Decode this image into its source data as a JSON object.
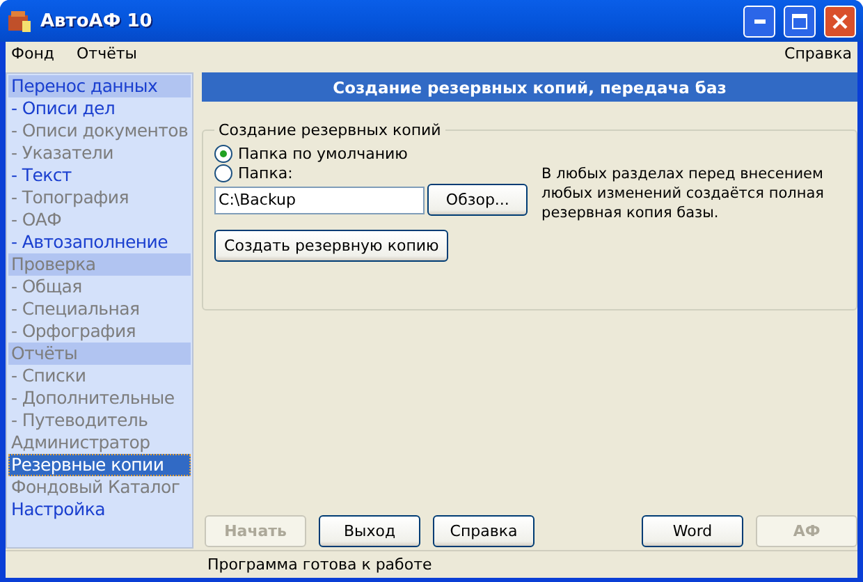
{
  "window": {
    "title": "АвтоАФ 10"
  },
  "menu": {
    "left": [
      {
        "label": "Фонд"
      },
      {
        "label": "Отчёты"
      }
    ],
    "right": [
      {
        "label": "Справка"
      }
    ]
  },
  "sidebar": {
    "items": [
      {
        "label": "Перенос данных",
        "kind": "header",
        "enabled": true,
        "selected": false
      },
      {
        "label": "- Описи дел",
        "kind": "item",
        "enabled": true,
        "selected": false
      },
      {
        "label": "- Описи документов",
        "kind": "item",
        "enabled": false,
        "selected": false
      },
      {
        "label": "- Указатели",
        "kind": "item",
        "enabled": false,
        "selected": false
      },
      {
        "label": "- Текст",
        "kind": "item",
        "enabled": true,
        "selected": false
      },
      {
        "label": "- Топография",
        "kind": "item",
        "enabled": false,
        "selected": false
      },
      {
        "label": "- ОАФ",
        "kind": "item",
        "enabled": false,
        "selected": false
      },
      {
        "label": "- Автозаполнение",
        "kind": "item",
        "enabled": true,
        "selected": false
      },
      {
        "label": "Проверка",
        "kind": "header",
        "enabled": false,
        "selected": false
      },
      {
        "label": "- Общая",
        "kind": "item",
        "enabled": false,
        "selected": false
      },
      {
        "label": "- Специальная",
        "kind": "item",
        "enabled": false,
        "selected": false
      },
      {
        "label": "- Орфография",
        "kind": "item",
        "enabled": false,
        "selected": false
      },
      {
        "label": "Отчёты",
        "kind": "header",
        "enabled": false,
        "selected": false
      },
      {
        "label": "- Списки",
        "kind": "item",
        "enabled": false,
        "selected": false
      },
      {
        "label": "- Дополнительные",
        "kind": "item",
        "enabled": false,
        "selected": false
      },
      {
        "label": "- Путеводитель",
        "kind": "item",
        "enabled": false,
        "selected": false
      },
      {
        "label": "Администратор",
        "kind": "item",
        "enabled": false,
        "selected": false
      },
      {
        "label": "Резервные копии",
        "kind": "item",
        "enabled": true,
        "selected": true
      },
      {
        "label": "Фондовый Каталог",
        "kind": "item",
        "enabled": false,
        "selected": false
      },
      {
        "label": "Настройка",
        "kind": "item",
        "enabled": true,
        "selected": false
      }
    ]
  },
  "panel": {
    "title": "Создание резервных копий, передача баз",
    "group": {
      "title": "Создание резервных копий",
      "radios": [
        {
          "label": "Папка по умолчанию",
          "selected": true
        },
        {
          "label": "Папка:",
          "selected": false
        }
      ],
      "folder": {
        "value": "C:\\Backup"
      },
      "browse_button": "Обзор...",
      "create_button": "Создать резервную копию",
      "note": "В любых разделах перед внесением любых изменений создаётся полная резервная копия базы."
    }
  },
  "buttons": [
    {
      "label": "Начать",
      "disabled": true
    },
    {
      "label": "Выход",
      "disabled": false
    },
    {
      "label": "Справка",
      "disabled": false
    },
    {
      "label": "Word",
      "disabled": false
    },
    {
      "label": "АФ",
      "disabled": true
    }
  ],
  "status_bar": {
    "text": "Программа готова к работе"
  }
}
